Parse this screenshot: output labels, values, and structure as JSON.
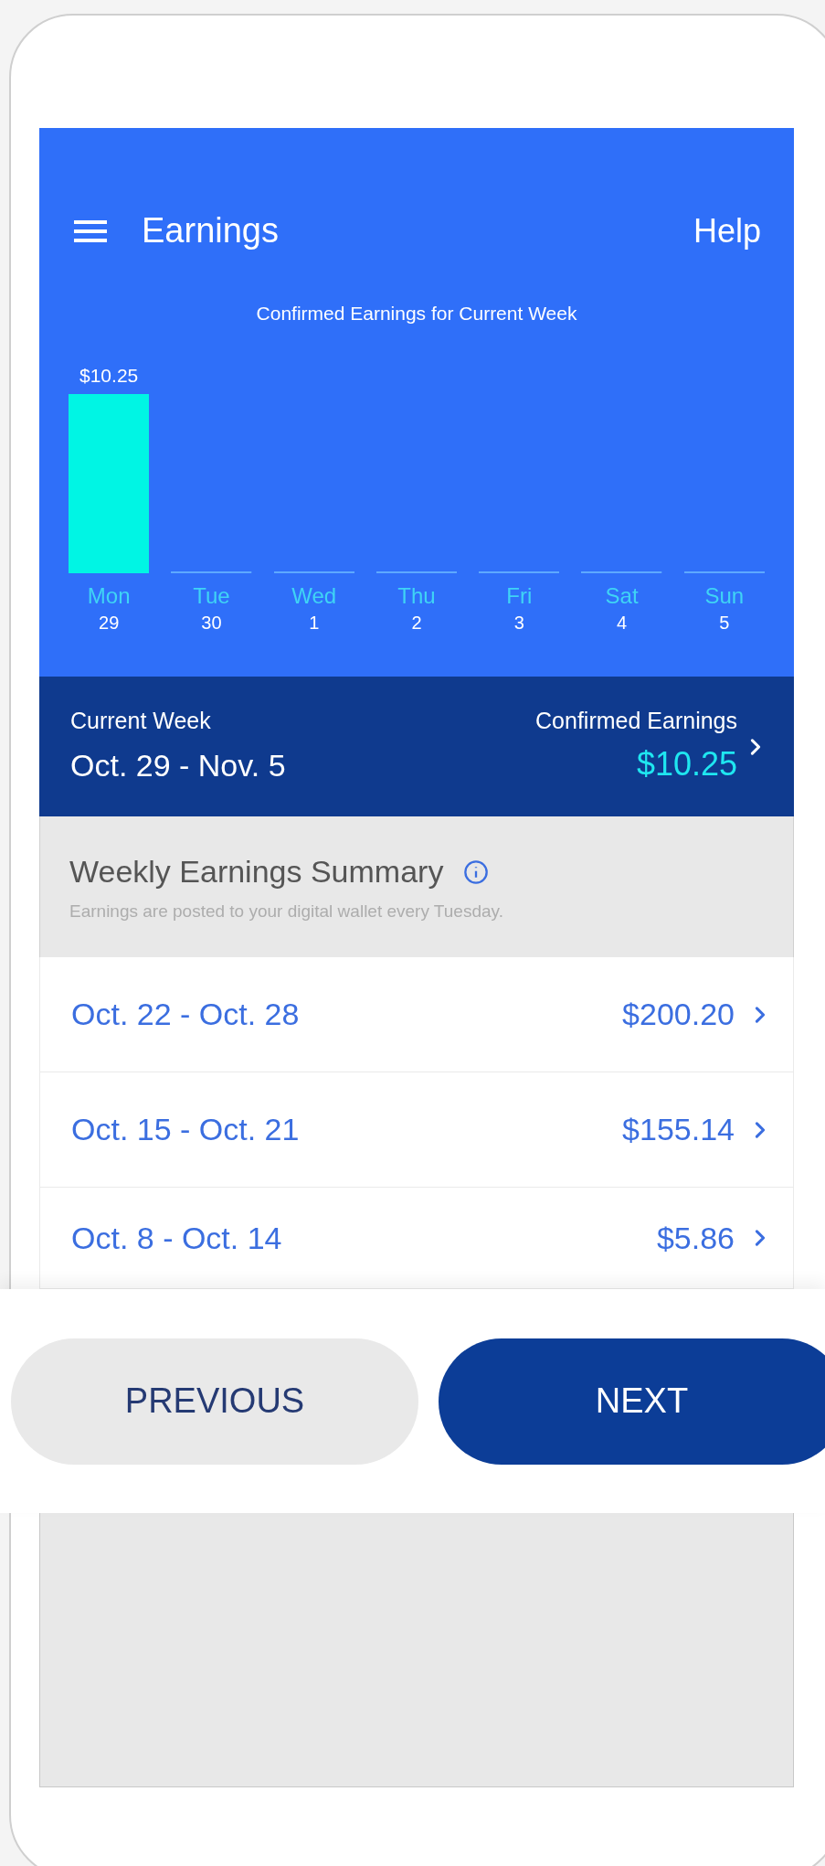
{
  "app_bar": {
    "title": "Earnings",
    "help": "Help"
  },
  "chart": {
    "title": "Confirmed Earnings for Current Week",
    "day_numbers": [
      "29",
      "30",
      "1",
      "2",
      "3",
      "4",
      "5"
    ],
    "chart_data": {
      "type": "bar",
      "categories": [
        "Mon",
        "Tue",
        "Wed",
        "Thu",
        "Fri",
        "Sat",
        "Sun"
      ],
      "values": [
        10.25,
        0,
        0,
        0,
        0,
        0,
        0
      ],
      "value_labels": [
        "$10.25",
        null,
        null,
        null,
        null,
        null,
        null
      ]
    }
  },
  "current_week": {
    "label": "Current Week",
    "range": "Oct. 29 - Nov. 5",
    "earnings_label": "Confirmed Earnings",
    "earnings": "$10.25"
  },
  "summary": {
    "title": "Weekly Earnings Summary",
    "subtitle": "Earnings are posted to your digital wallet every Tuesday.",
    "rows": [
      {
        "range": "Oct. 22 - Oct. 28",
        "amount": "$200.20"
      },
      {
        "range": "Oct. 15 - Oct. 21",
        "amount": "$155.14"
      },
      {
        "range": "Oct. 8 - Oct. 14",
        "amount": "$5.86"
      }
    ]
  },
  "buttons": [
    {
      "label": "PREVIOUS",
      "kind": "secondary"
    },
    {
      "label": "NEXT",
      "kind": "primary"
    }
  ]
}
